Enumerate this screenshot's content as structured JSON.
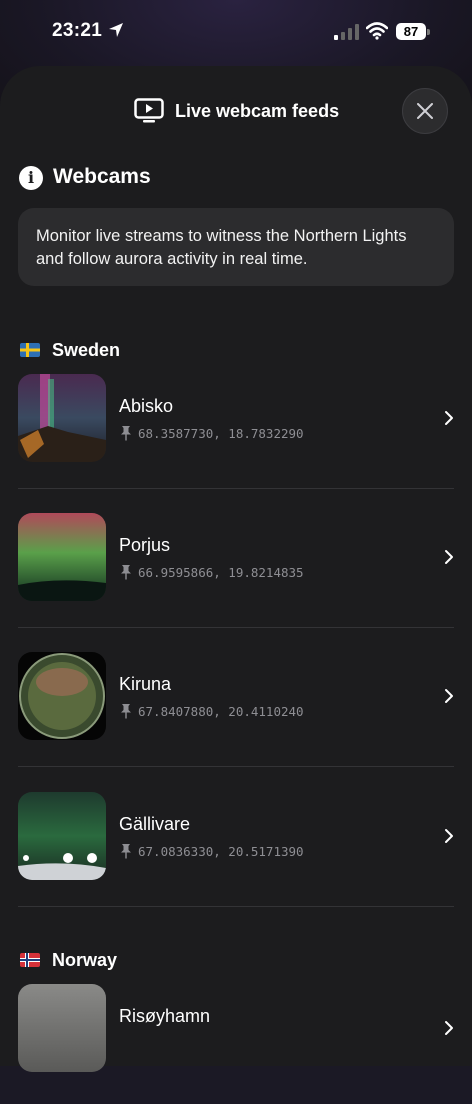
{
  "status_bar": {
    "time": "23:21",
    "battery": "87"
  },
  "header": {
    "title": "Live webcam feeds",
    "close_icon": "close-icon"
  },
  "section": {
    "title": "Webcams",
    "info": "Monitor live streams to witness the Northern Lights and follow aurora activity in real time."
  },
  "countries": [
    {
      "name": "Sweden",
      "webcams": [
        {
          "name": "Abisko",
          "coords": "68.3587730, 18.7832290"
        },
        {
          "name": "Porjus",
          "coords": "66.9595866, 19.8214835"
        },
        {
          "name": "Kiruna",
          "coords": "67.8407880, 20.4110240"
        },
        {
          "name": "Gällivare",
          "coords": "67.0836330, 20.5171390"
        }
      ]
    },
    {
      "name": "Norway",
      "webcams": [
        {
          "name": "Risøyhamn",
          "coords": ""
        }
      ]
    }
  ],
  "colors": {
    "sheet": "#1c1c1e",
    "card": "#2c2c2e",
    "secondary_text": "#8e8e93"
  }
}
